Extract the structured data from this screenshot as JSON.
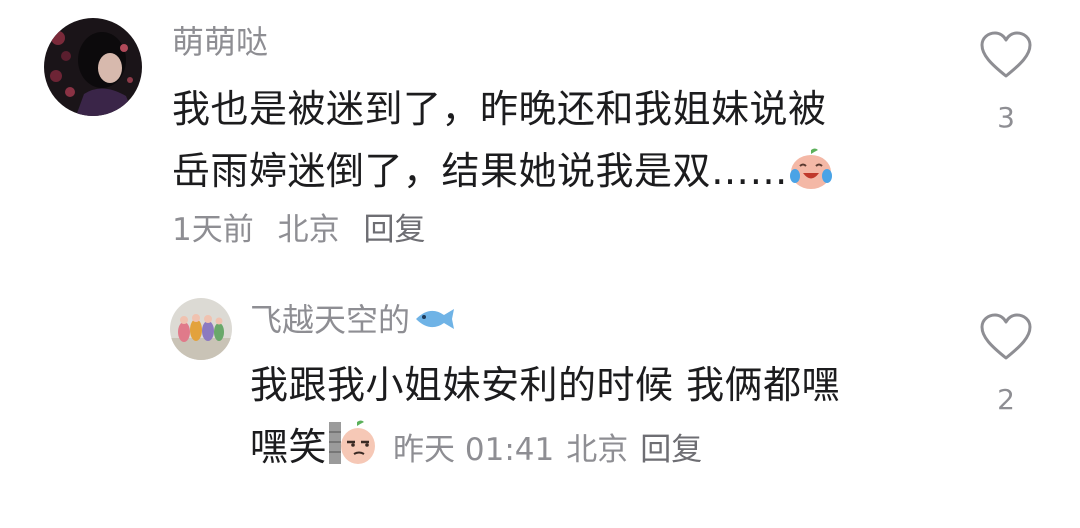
{
  "comments": [
    {
      "username": "萌萌哒",
      "text_line1": "我也是被迷到了，昨晚还和我姐妹说被",
      "text_line2": "岳雨婷迷倒了，结果她说我是双……",
      "emoji": "crying-laughing-peach-emoji",
      "time": "1天前",
      "location": "北京",
      "reply_label": "回复",
      "like_count": "3",
      "like_icon": "heart-outline-icon"
    },
    {
      "username": "飞越天空的",
      "username_badge": "fish-emoji",
      "text_line1": "我跟我小姐妹安利的时候 我俩都嘿",
      "text_line2": "嘿笑",
      "emoji": "peeking-wall-peach-emoji",
      "time": "昨天 01:41",
      "location": "北京",
      "reply_label": "回复",
      "like_count": "2",
      "like_icon": "heart-outline-icon"
    }
  ],
  "colors": {
    "text_primary": "#1c1c1e",
    "text_secondary": "#8e8e93",
    "heart_outline": "#8e8e93",
    "background": "#ffffff"
  }
}
